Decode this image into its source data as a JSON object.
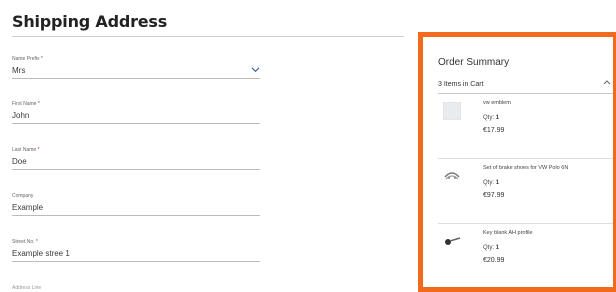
{
  "shipping": {
    "title": "Shipping Address",
    "fields": {
      "name_prefix": {
        "label": "Name Prefix",
        "value": "Mrs"
      },
      "first_name": {
        "label": "First Name",
        "value": "John"
      },
      "last_name": {
        "label": "Last Name",
        "value": "Doe"
      },
      "company": {
        "label": "Company",
        "value": "Example"
      },
      "street": {
        "label": "Street No.",
        "value": "Example stree 1"
      }
    },
    "required_mark": "*",
    "next_label_partial": "Address Line"
  },
  "summary": {
    "title": "Order Summary",
    "items_count": "3 Items in Cart",
    "qty_label": "Qty:",
    "items": [
      {
        "name": "vw emblem",
        "qty": "1",
        "price": "€17.99",
        "icon": "emblem-placeholder-icon"
      },
      {
        "name": "Set of brake shoes for VW Polo 6N",
        "qty": "1",
        "price": "€97.99",
        "icon": "brake-shoes-icon"
      },
      {
        "name": "Key blank AH profile",
        "qty": "1",
        "price": "€20.99",
        "icon": "key-icon"
      }
    ]
  },
  "colors": {
    "accent_border": "#f26a1b"
  }
}
